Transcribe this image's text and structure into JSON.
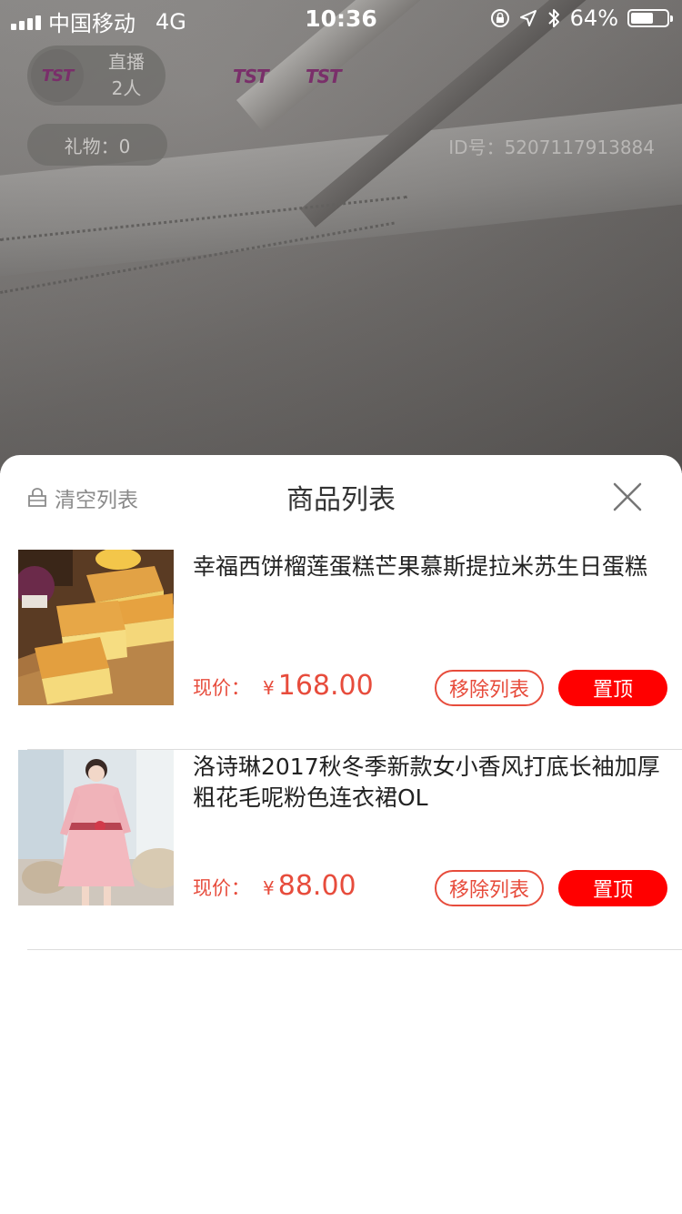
{
  "status_bar": {
    "carrier": "中国移动",
    "network": "4G",
    "time": "10:36",
    "battery_percent": "64%",
    "battery_level": 0.64
  },
  "live": {
    "host_status": "直播",
    "viewer_count": "2人",
    "host_logo": "TST",
    "viewer_logos": [
      "TST",
      "TST"
    ],
    "gift_label": "礼物：0",
    "room_id": "ID号：5207117913884"
  },
  "sheet": {
    "clear_label": "清空列表",
    "title": "商品列表"
  },
  "products": [
    {
      "name": "幸福西饼榴莲蛋糕芒果慕斯提拉米苏生日蛋糕",
      "price_label": "现价：",
      "currency": "¥",
      "price": "168.00",
      "remove_label": "移除列表",
      "top_label": "置顶"
    },
    {
      "name": "洛诗琳2017秋冬季新款女小香风打底长袖加厚粗花毛呢粉色连衣裙OL",
      "price_label": "现价：",
      "currency": "¥",
      "price": "88.00",
      "remove_label": "移除列表",
      "top_label": "置顶"
    }
  ],
  "colors": {
    "accent_red": "#ff0000",
    "price_red": "#e74c3c",
    "sheet_bg": "#ffffff",
    "overlay_pill": "#6e6c6a"
  }
}
